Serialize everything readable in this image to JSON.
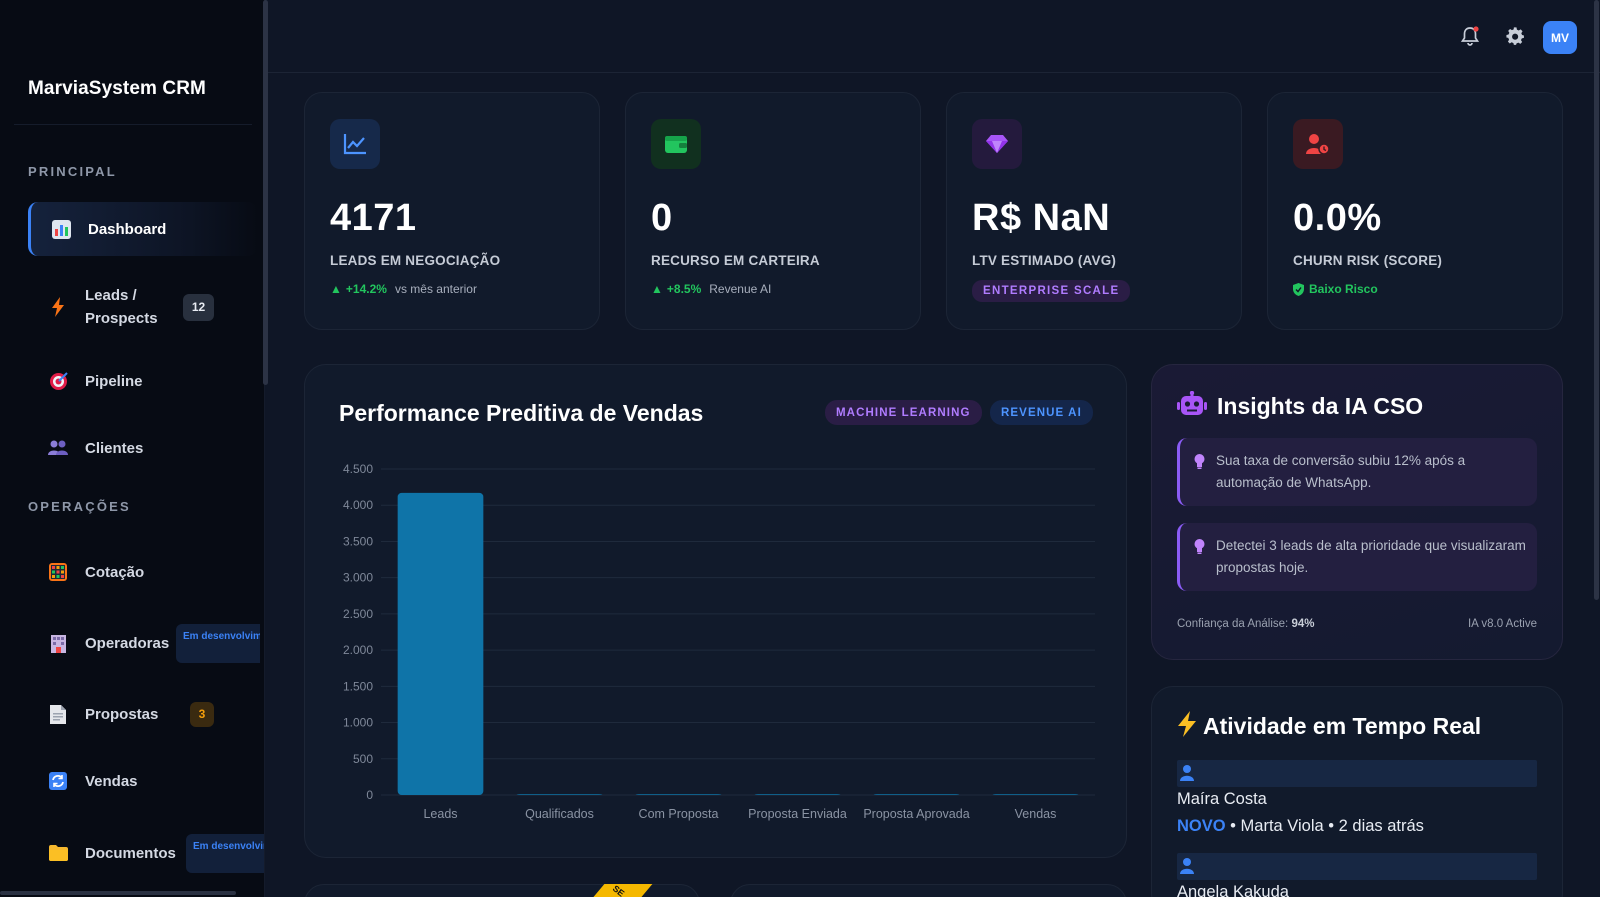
{
  "sidebar": {
    "brand": "MarviaSystem CRM",
    "sections": [
      {
        "title": "PRINCIPAL"
      },
      {
        "title": "OPERAÇÕES"
      }
    ],
    "items": [
      {
        "label": "Dashboard",
        "icon": "bar-chart-icon"
      },
      {
        "label": "Leads / Prospects",
        "icon": "lightning-icon",
        "badge": "12"
      },
      {
        "label": "Pipeline",
        "icon": "target-icon"
      },
      {
        "label": "Clientes",
        "icon": "people-icon"
      },
      {
        "label": "Cotação",
        "icon": "calculator-icon"
      },
      {
        "label": "Operadoras",
        "icon": "building-icon",
        "badge": "Em desenvolvimen"
      },
      {
        "label": "Propostas",
        "icon": "document-icon",
        "badge": "3"
      },
      {
        "label": "Vendas",
        "icon": "refresh-icon"
      },
      {
        "label": "Documentos",
        "icon": "folder-icon",
        "badge": "Em desenvolvime"
      }
    ]
  },
  "topbar": {
    "avatar": "MV",
    "icons": [
      "bell-icon",
      "gear-icon"
    ]
  },
  "kpis": [
    {
      "value": "4171",
      "label": "LEADS EM NEGOCIAÇÃO",
      "trend": "+14.2%",
      "note": "vs mês anterior",
      "icon": "trend-chart-icon",
      "color": "#3b82f6"
    },
    {
      "value": "0",
      "label": "RECURSO EM CARTEIRA",
      "trend": "+8.5%",
      "note": "Revenue AI",
      "icon": "wallet-icon",
      "color": "#22c55e"
    },
    {
      "value": "R$ NaN",
      "label": "LTV ESTIMADO (AVG)",
      "pill": "ENTERPRISE SCALE",
      "icon": "gem-icon",
      "color": "#a855f7"
    },
    {
      "value": "0.0%",
      "label": "CHURN RISK (SCORE)",
      "risk": "Baixo Risco",
      "icon": "user-alert-icon",
      "color": "#ef4444"
    }
  ],
  "chart": {
    "title": "Performance Preditiva de Vendas",
    "tags": [
      "MACHINE LEARNING",
      "REVENUE AI"
    ]
  },
  "chart_data": {
    "type": "bar",
    "categories": [
      "Leads",
      "Qualificados",
      "Com Proposta",
      "Proposta Enviada",
      "Proposta Aprovada",
      "Vendas"
    ],
    "values": [
      4171,
      0,
      0,
      0,
      0,
      0
    ],
    "yticks": [
      "0",
      "500",
      "1.000",
      "1.500",
      "2.000",
      "2.500",
      "3.000",
      "3.500",
      "4.000",
      "4.500"
    ],
    "ylim": [
      0,
      4500
    ],
    "grid": true,
    "bar_color": "#0f74a8"
  },
  "insights": {
    "title": "Insights da IA CSO",
    "items": [
      "Sua taxa de conversão subiu 12% após a automação de WhatsApp.",
      "Detectei 3 leads de alta prioridade que visualizaram propostas hoje."
    ],
    "confidence_label": "Confiança da Análise:",
    "confidence_value": "94%",
    "version": "IA v8.0 Active"
  },
  "activity": {
    "title": "Atividade em Tempo Real",
    "entries": [
      {
        "name": "Maíra Costa",
        "status": "NOVO",
        "detail": " • Marta Viola • 2 dias atrás"
      },
      {
        "name": "Angela Kakuda"
      }
    ]
  },
  "ribbon": "SE"
}
